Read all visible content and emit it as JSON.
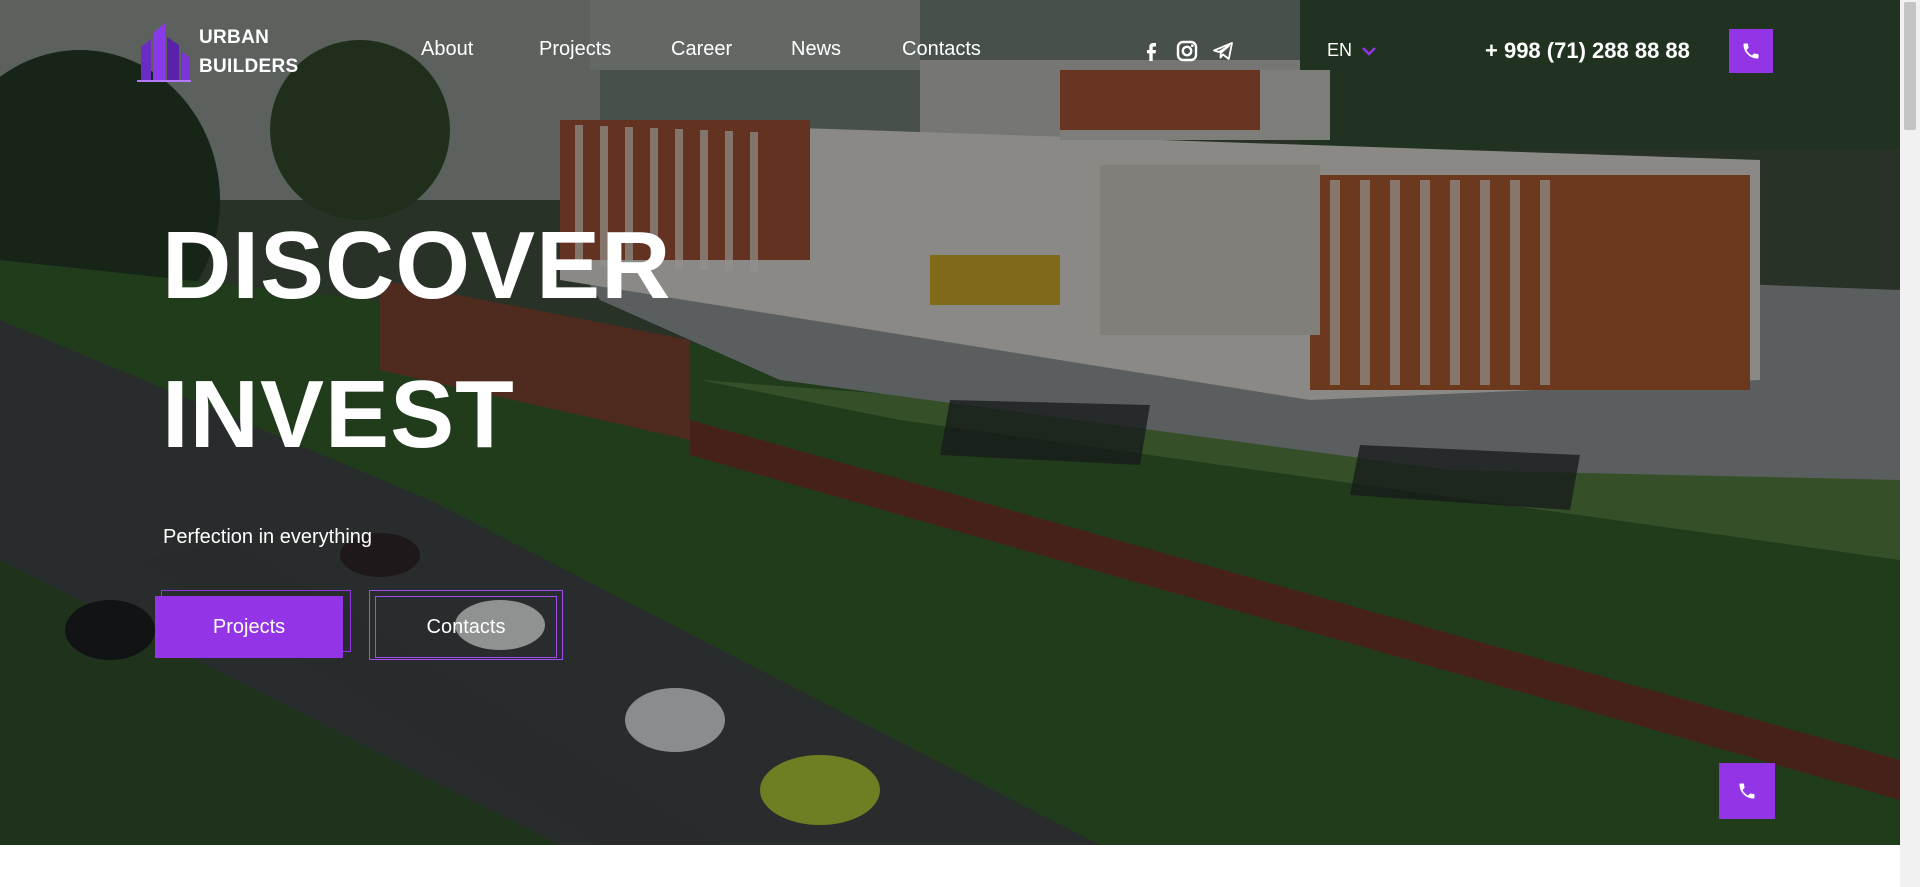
{
  "brand": {
    "line1": "URBAN",
    "line2": "BUILDERS"
  },
  "nav": [
    {
      "label": "About"
    },
    {
      "label": "Projects"
    },
    {
      "label": "Career"
    },
    {
      "label": "News"
    },
    {
      "label": "Contacts"
    }
  ],
  "socials": [
    "facebook-icon",
    "instagram-icon",
    "telegram-icon"
  ],
  "language": {
    "current": "EN"
  },
  "phone": "+ 998 (71) 288 88 88",
  "hero": {
    "title_line1": "DISCOVER",
    "title_line2": "INVEST",
    "subtitle": "Perfection in everything",
    "primary_button": "Projects",
    "secondary_button": "Contacts"
  },
  "colors": {
    "accent": "#9334e6",
    "text": "#ffffff"
  }
}
